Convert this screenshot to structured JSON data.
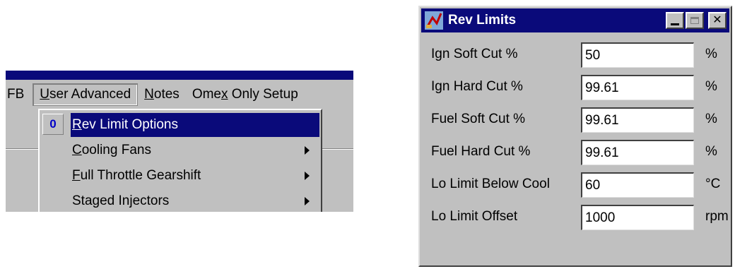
{
  "menubar": {
    "items": [
      {
        "label": "FB"
      },
      {
        "label_pre": "",
        "label_u": "U",
        "label_post": "ser Advanced"
      },
      {
        "label_pre": "",
        "label_u": "N",
        "label_post": "otes"
      },
      {
        "label_pre": "Ome",
        "label_u": "x",
        "label_post": " Only Setup"
      }
    ]
  },
  "dropdown": {
    "icon_glyph": "0",
    "items": [
      {
        "label_u": "R",
        "label_post": "ev Limit Options",
        "selected": true
      },
      {
        "label_u": "C",
        "label_post": "ooling Fans",
        "submenu": true
      },
      {
        "label_u": "F",
        "label_post": "ull Throttle Gearshift",
        "submenu": true
      },
      {
        "label_u": "",
        "label_post": "Staged Injectors",
        "submenu": true
      }
    ]
  },
  "dialog": {
    "title": "Rev Limits",
    "minimize_icon": "minimize-icon",
    "maximize_icon": "maximize-icon",
    "close_label": "✕",
    "rows": [
      {
        "label": "Ign Soft Cut %",
        "value": "50",
        "unit": "%"
      },
      {
        "label": "Ign Hard Cut %",
        "value": "99.61",
        "unit": "%"
      },
      {
        "label": "Fuel Soft Cut %",
        "value": "99.61",
        "unit": "%"
      },
      {
        "label": "Fuel Hard Cut %",
        "value": "99.61",
        "unit": "%"
      },
      {
        "label": "Lo Limit Below Cool",
        "value": "60",
        "unit": "°C"
      },
      {
        "label": "Lo Limit Offset",
        "value": "1000",
        "unit": "rpm"
      }
    ]
  },
  "colors": {
    "titlebar": "#0a0a7a",
    "face": "#c0c0c0",
    "highlight": "#0a0a7a",
    "icon_glyph": "#0000c8"
  }
}
